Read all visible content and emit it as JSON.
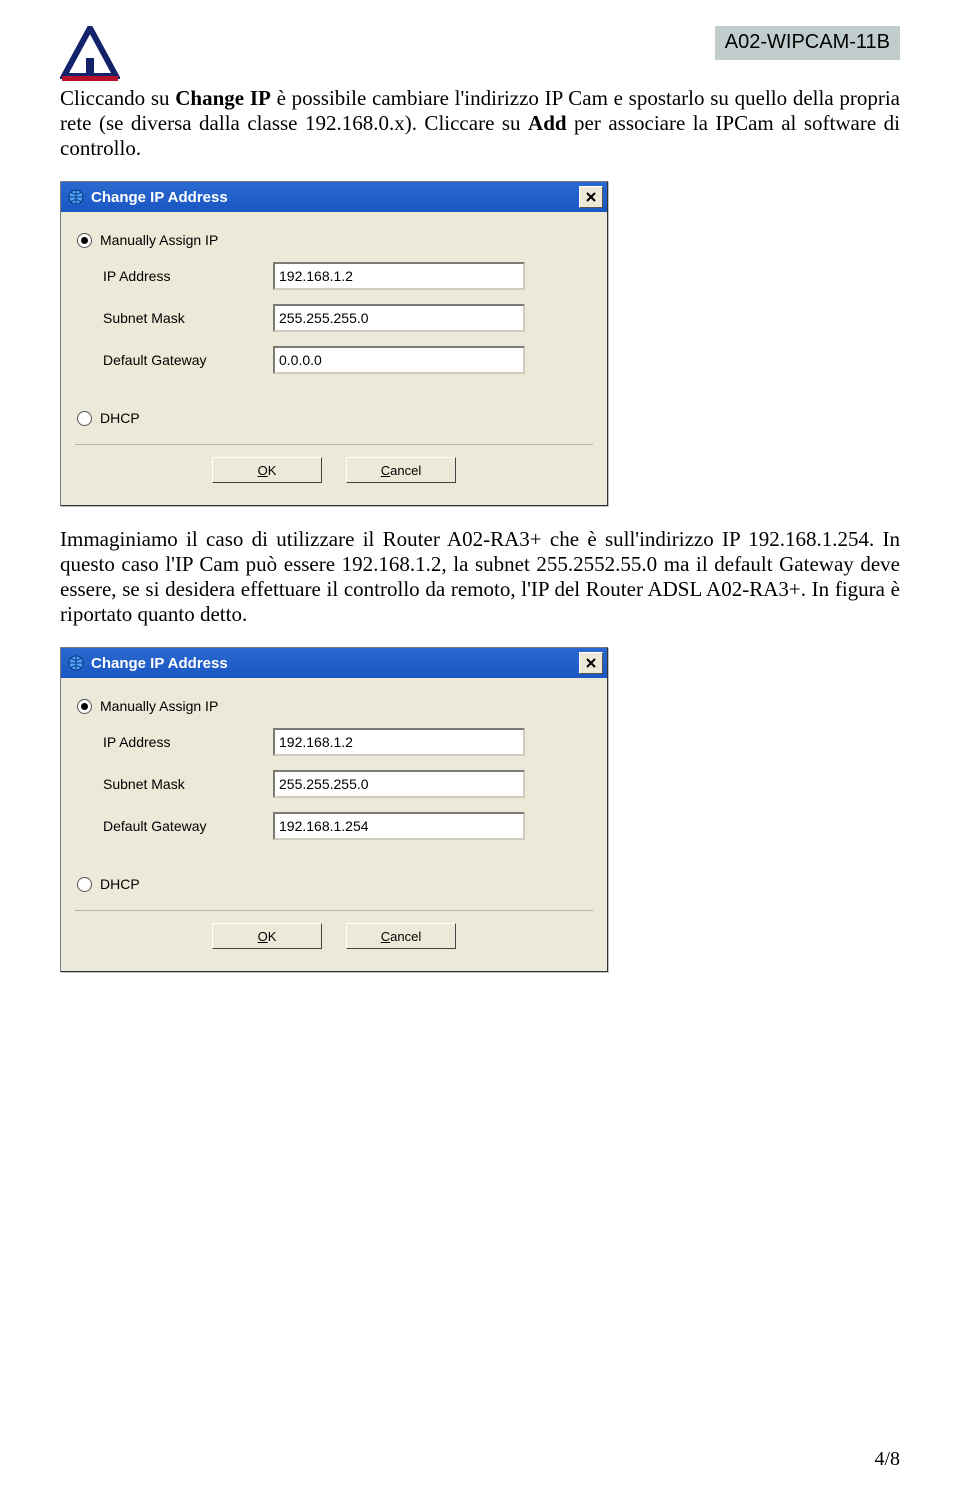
{
  "header": {
    "model_badge": "A02-WIPCAM-11B"
  },
  "para1": {
    "p1a": "Cliccando su ",
    "b1": "Change IP",
    "p1b": " è possibile cambiare l'indirizzo IP Cam e spostarlo su quello della propria rete (se diversa dalla classe 192.168.0.x). Cliccare su ",
    "b2": "Add",
    "p1c": " per associare la IPCam al software di controllo."
  },
  "para2": "Immaginiamo il caso di utilizzare il Router A02-RA3+ che è sull'indirizzo IP 192.168.1.254. In questo caso l'IP Cam può essere 192.168.1.2, la subnet 255.2552.55.0 ma il default Gateway deve essere, se si desidera effettuare il controllo da remoto, l'IP del Router ADSL A02-RA3+.  In figura è riportato quanto detto.",
  "dialog_shared": {
    "title": "Change IP Address",
    "opt_manual": "Manually Assign IP",
    "lbl_ip": "IP Address",
    "lbl_mask": "Subnet Mask",
    "lbl_gw": "Default Gateway",
    "opt_dhcp": "DHCP",
    "btn_ok_u": "O",
    "btn_ok_r": "K",
    "btn_cancel_u": "C",
    "btn_cancel_r": "ancel"
  },
  "dialog1": {
    "ip": "192.168.1.2",
    "mask": "255.255.255.0",
    "gw": "0.0.0.0"
  },
  "dialog2": {
    "ip": "192.168.1.2",
    "mask": "255.255.255.0",
    "gw": "192.168.1.254"
  },
  "footer": {
    "page": "4/8"
  }
}
